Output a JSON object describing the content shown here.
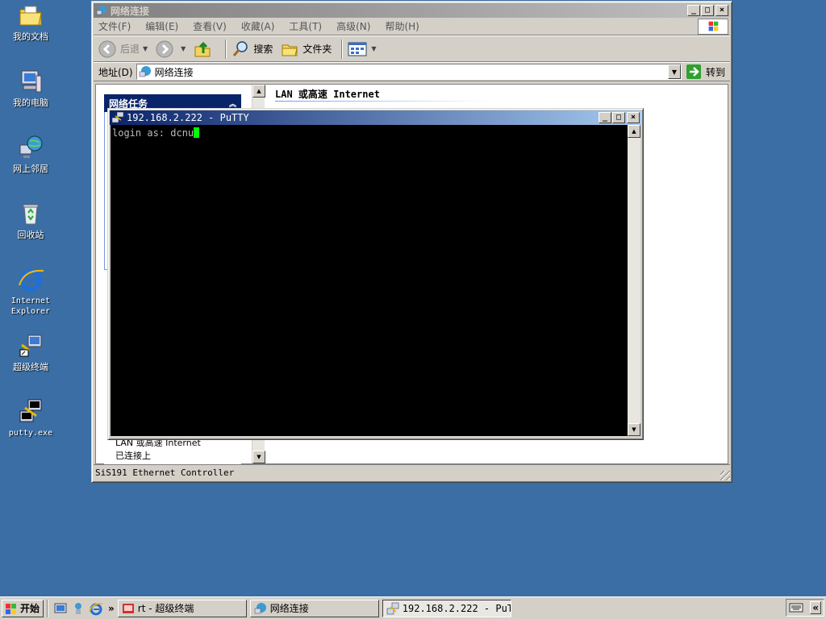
{
  "desktop": {
    "icons": [
      {
        "label": "我的文档"
      },
      {
        "label": "我的电脑"
      },
      {
        "label": "网上邻居"
      },
      {
        "label": "回收站"
      },
      {
        "label": "Internet Explorer"
      },
      {
        "label": "超级终端"
      },
      {
        "label": "putty.exe"
      }
    ]
  },
  "explorer": {
    "title": "网络连接",
    "menu": [
      "文件(F)",
      "编辑(E)",
      "查看(V)",
      "收藏(A)",
      "工具(T)",
      "高级(N)",
      "帮助(H)"
    ],
    "toolbar": {
      "back": "后退",
      "search": "搜索",
      "folders": "文件夹"
    },
    "address": {
      "label": "地址(D)",
      "value": "网络连接",
      "go": "转到"
    },
    "task_pane": {
      "header": "网络任务",
      "item1": "LAN 或高速 Internet",
      "item2": "已连接上"
    },
    "section_title": "LAN 或高速 Internet",
    "status": "SiS191 Ethernet Controller"
  },
  "putty": {
    "title": "192.168.2.222 - PuTTY",
    "terminal_text": "login as: dcnu"
  },
  "taskbar": {
    "start": "开始",
    "tasks": [
      {
        "label": "rt - 超级终端"
      },
      {
        "label": "网络连接"
      },
      {
        "label": "192.168.2.222 - PuTTY"
      }
    ]
  },
  "colors": {
    "desktop": "#3a6ea5",
    "title_active": "#0a246a",
    "cursor": "#00ff00"
  }
}
